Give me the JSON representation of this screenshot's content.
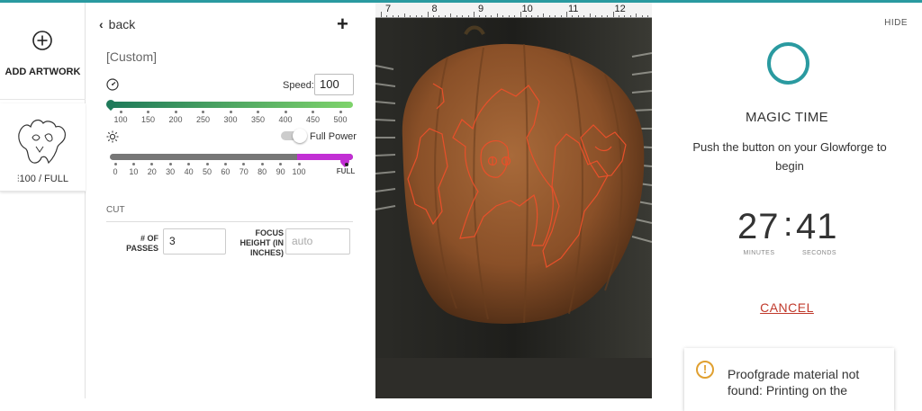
{
  "rail": {
    "add_artwork_label": "ADD ARTWORK",
    "thumbnail_label": "100 / FULL"
  },
  "settings": {
    "back_label": "back",
    "add_label": "+",
    "preset_name": "[Custom]",
    "speed_label": "Speed:",
    "speed_value": "100",
    "speed_ticks": [
      "100",
      "150",
      "200",
      "250",
      "300",
      "350",
      "400",
      "450",
      "500"
    ],
    "speed_fraction": 0.0,
    "power_ticks": [
      "0",
      "10",
      "20",
      "30",
      "40",
      "50",
      "60",
      "70",
      "80",
      "90",
      "100",
      "FULL"
    ],
    "full_power_label": "Full Power",
    "full_power_on": true,
    "section_label": "CUT",
    "passes_label": "# OF PASSES",
    "passes_value": "3",
    "focus_label": "FOCUS HEIGHT (IN INCHES)",
    "focus_placeholder": "auto"
  },
  "camera": {
    "ruler_numbers": [
      "7",
      "8",
      "9",
      "10",
      "11",
      "12"
    ]
  },
  "print_panel": {
    "hide_label": "HIDE",
    "title": "MAGIC TIME",
    "instruction": "Push the button on your Glowforge to begin",
    "minutes": "27",
    "seconds": "41",
    "minutes_label": "MINUTES",
    "seconds_label": "SECONDS",
    "colon": ":",
    "cancel_label": "CANCEL",
    "warning_text": "Proofgrade material not found: Printing on the"
  },
  "colors": {
    "accent": "#2a9aa0",
    "speed_gradient_start": "#1f7a5a",
    "speed_gradient_end": "#7ed36b",
    "power_full": "#c22fd4",
    "cancel": "#c0392b",
    "warning": "#e0a030",
    "artwork_line": "#e8502a"
  },
  "icons": {
    "add": "plus-circle-icon",
    "back": "chevron-left-icon",
    "speed": "speedometer-icon",
    "power": "sun-icon",
    "warning": "exclamation-circle-icon"
  }
}
